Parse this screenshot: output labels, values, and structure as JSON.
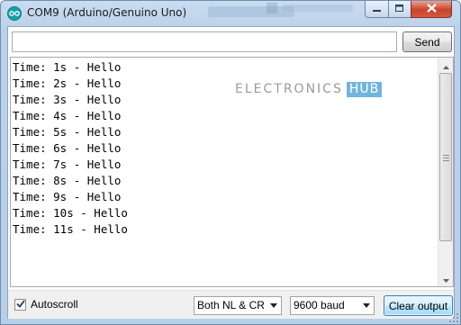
{
  "window": {
    "title": "COM9 (Arduino/Genuino Uno)"
  },
  "send_bar": {
    "input_value": "",
    "input_placeholder": "",
    "send_label": "Send"
  },
  "output": {
    "lines": [
      "Time: 1s - Hello",
      "Time: 2s - Hello",
      "Time: 3s - Hello",
      "Time: 4s - Hello",
      "Time: 5s - Hello",
      "Time: 6s - Hello",
      "Time: 7s - Hello",
      "Time: 8s - Hello",
      "Time: 9s - Hello",
      "Time: 10s - Hello",
      "Time: 11s - Hello"
    ],
    "watermark": {
      "text": "ELECTRONICS",
      "highlight": "HUB"
    }
  },
  "bottom_bar": {
    "autoscroll_label": "Autoscroll",
    "autoscroll_checked": true,
    "line_ending_value": "Both NL & CR",
    "baud_value": "9600 baud",
    "clear_label": "Clear output"
  },
  "colors": {
    "app_icon": "#14a0a8",
    "close_button": "#c8432a",
    "watermark_hub": "#5aa7d8"
  },
  "icons": {
    "app": "arduino-icon",
    "minimize": "minimize-icon",
    "maximize": "maximize-icon",
    "close": "close-icon",
    "check": "checkmark-icon",
    "dropdown": "chevron-down-icon",
    "scroll_up": "arrow-up-icon",
    "scroll_down": "arrow-down-icon"
  }
}
